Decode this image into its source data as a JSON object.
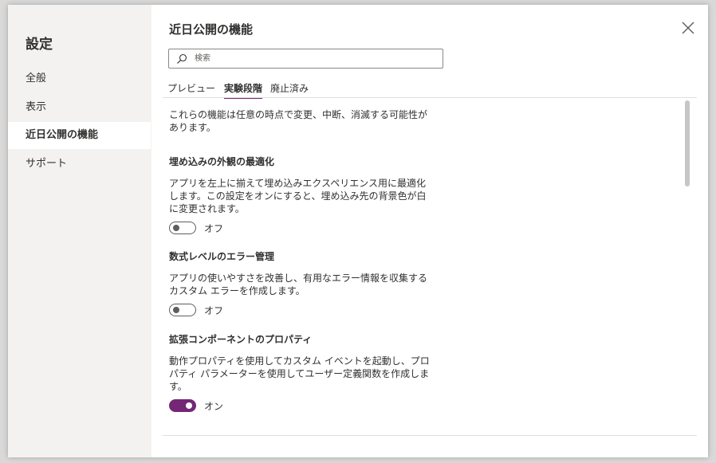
{
  "sidebar": {
    "title": "設定",
    "items": [
      {
        "label": "全般",
        "active": false
      },
      {
        "label": "表示",
        "active": false
      },
      {
        "label": "近日公開の機能",
        "active": true
      },
      {
        "label": "サポート",
        "active": false
      }
    ]
  },
  "main": {
    "title": "近日公開の機能",
    "search": {
      "placeholder": "検索",
      "value": ""
    },
    "tabs": [
      {
        "label": "プレビュー",
        "active": false
      },
      {
        "label": "実験段階",
        "active": true
      },
      {
        "label": "廃止済み",
        "active": false
      }
    ],
    "intro_line1": "これらの機能は任意の時点で変更、中断、消滅する可能性が",
    "intro_line2": "あります。",
    "features": [
      {
        "title": "埋め込みの外観の最適化",
        "desc_lines": [
          "アプリを左上に揃えて埋め込みエクスペリエンス用に最適化",
          "します。この設定をオンにすると、埋め込み先の背景色が白",
          "に変更されます。"
        ],
        "toggle_label": "オフ",
        "enabled": false
      },
      {
        "title": "数式レベルのエラー管理",
        "desc_lines": [
          "アプリの使いやすさを改善し、有用なエラー情報を収集する",
          "カスタム エラーを作成します。"
        ],
        "toggle_label": "オフ",
        "enabled": false
      },
      {
        "title": "拡張コンポーネントのプロパティ",
        "desc_lines": [
          "動作プロパティを使用してカスタム イベントを起動し、プロ",
          "パティ パラメーターを使用してユーザー定義関数を作成しま",
          "す。"
        ],
        "toggle_label": "オン",
        "enabled": true
      }
    ]
  },
  "colors": {
    "accent": "#742774",
    "sidebar_bg": "#f3f2f1",
    "text": "#323130"
  },
  "icons": {
    "close": "close-icon",
    "search": "search-icon"
  }
}
